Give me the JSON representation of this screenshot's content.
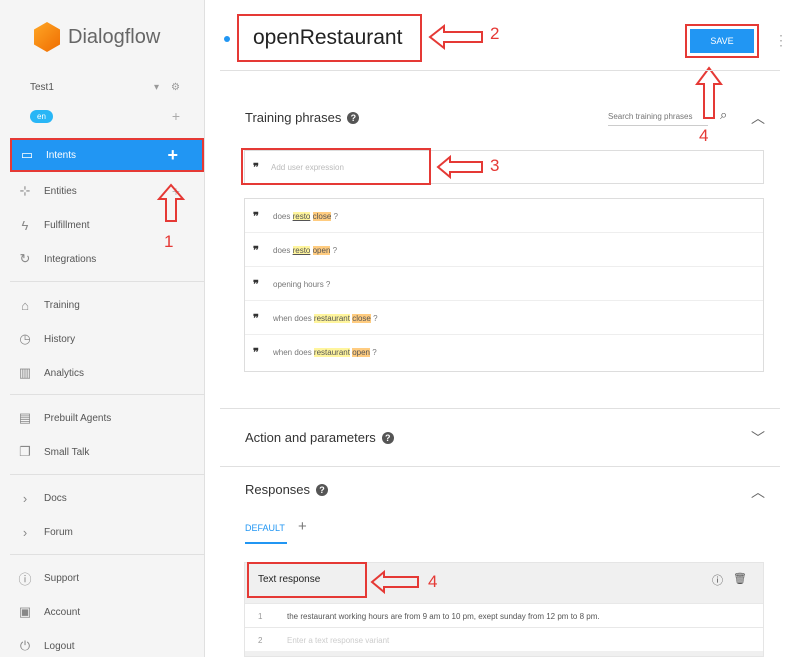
{
  "brand": {
    "name": "Dialogflow"
  },
  "agent": {
    "name": "Test1",
    "language": "en"
  },
  "nav": {
    "intents": "Intents",
    "entities": "Entities",
    "fulfillment": "Fulfillment",
    "integrations": "Integrations",
    "training": "Training",
    "history": "History",
    "analytics": "Analytics",
    "prebuilt_agents": "Prebuilt Agents",
    "small_talk": "Small Talk",
    "docs": "Docs",
    "forum": "Forum",
    "support": "Support",
    "account": "Account",
    "logout": "Logout"
  },
  "intent": {
    "name": "openRestaurant",
    "save_label": "SAVE"
  },
  "training": {
    "title": "Training phrases",
    "search_placeholder": "Search training phrases",
    "add_placeholder": "Add user expression",
    "phrases": [
      {
        "pre": "does ",
        "entity": "resto",
        "mid": " ",
        "param": "close",
        "post": " ?"
      },
      {
        "pre": "does ",
        "entity": "resto",
        "mid": " ",
        "param": "open",
        "post": " ?"
      },
      {
        "pre": "opening hours ?",
        "entity": "",
        "mid": "",
        "param": "",
        "post": ""
      },
      {
        "pre": "when does ",
        "entity": "restaurant",
        "mid": " ",
        "param": "close",
        "post": " ?"
      },
      {
        "pre": "when does ",
        "entity": "restaurant",
        "mid": " ",
        "param": "open",
        "post": " ?"
      }
    ]
  },
  "actions": {
    "title": "Action and parameters"
  },
  "responses": {
    "title": "Responses",
    "tab_default": "DEFAULT",
    "card_title": "Text response",
    "rows": [
      {
        "num": "1",
        "text": "the restaurant working hours are from 9 am to 10 pm, exept sunday from 12 pm to 8 pm."
      },
      {
        "num": "2",
        "text": "Enter a text response variant"
      }
    ]
  },
  "annotations": {
    "a1": "1",
    "a2": "2",
    "a3": "3",
    "a4_save": "4",
    "a4_resp": "4"
  },
  "colors": {
    "accent": "#2196f3",
    "annotation": "#e53935",
    "entity_highlight": "#fff59d",
    "param_highlight": "#ffcc80"
  }
}
